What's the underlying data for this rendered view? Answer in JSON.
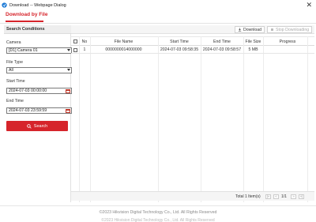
{
  "window": {
    "title": "Download -- Webpage Dialog",
    "close_glyph": "✕"
  },
  "tabs": [
    {
      "label": "Download by File",
      "active": true
    }
  ],
  "search_panel": {
    "title": "Search Conditions",
    "camera_label": "Camera",
    "camera_value": "[D1] Camera 01",
    "file_type_label": "File Type",
    "file_type_value": "All",
    "start_time_label": "Start Time",
    "start_time_value": "2024-07-03 00:00:00",
    "end_time_label": "End Time",
    "end_time_value": "2024-07-03 23:59:59",
    "search_button": "Search"
  },
  "toolbar": {
    "download_label": "Download",
    "stop_label": "Stop Downloading"
  },
  "table": {
    "columns": [
      "No",
      "File Name",
      "Start Time",
      "End Time",
      "File Size",
      "Progress"
    ],
    "rows": [
      {
        "no": "1",
        "file_name": "0000000014000000",
        "start_time": "2024-07-03 09:58:35",
        "end_time": "2024-07-03 09:58:57",
        "file_size": "5 MB",
        "progress": ""
      }
    ]
  },
  "pager": {
    "total": "Total 1 Item(s)",
    "page": "1/1",
    "first": "|«",
    "prev": "«",
    "next": "»",
    "last": "»|"
  },
  "footer": {
    "copyright": "©2023 Hikvision Digital Technology Co., Ltd. All Rights Reserved",
    "ghost": "©2023 Hikvision Digital Technology Co., Ltd. All Rights Reserved"
  },
  "colors": {
    "accent": "#d6242b"
  },
  "icons": [
    "app-icon",
    "close-icon",
    "chevron-down-icon",
    "calendar-icon",
    "search-icon",
    "download-icon",
    "stop-icon"
  ]
}
